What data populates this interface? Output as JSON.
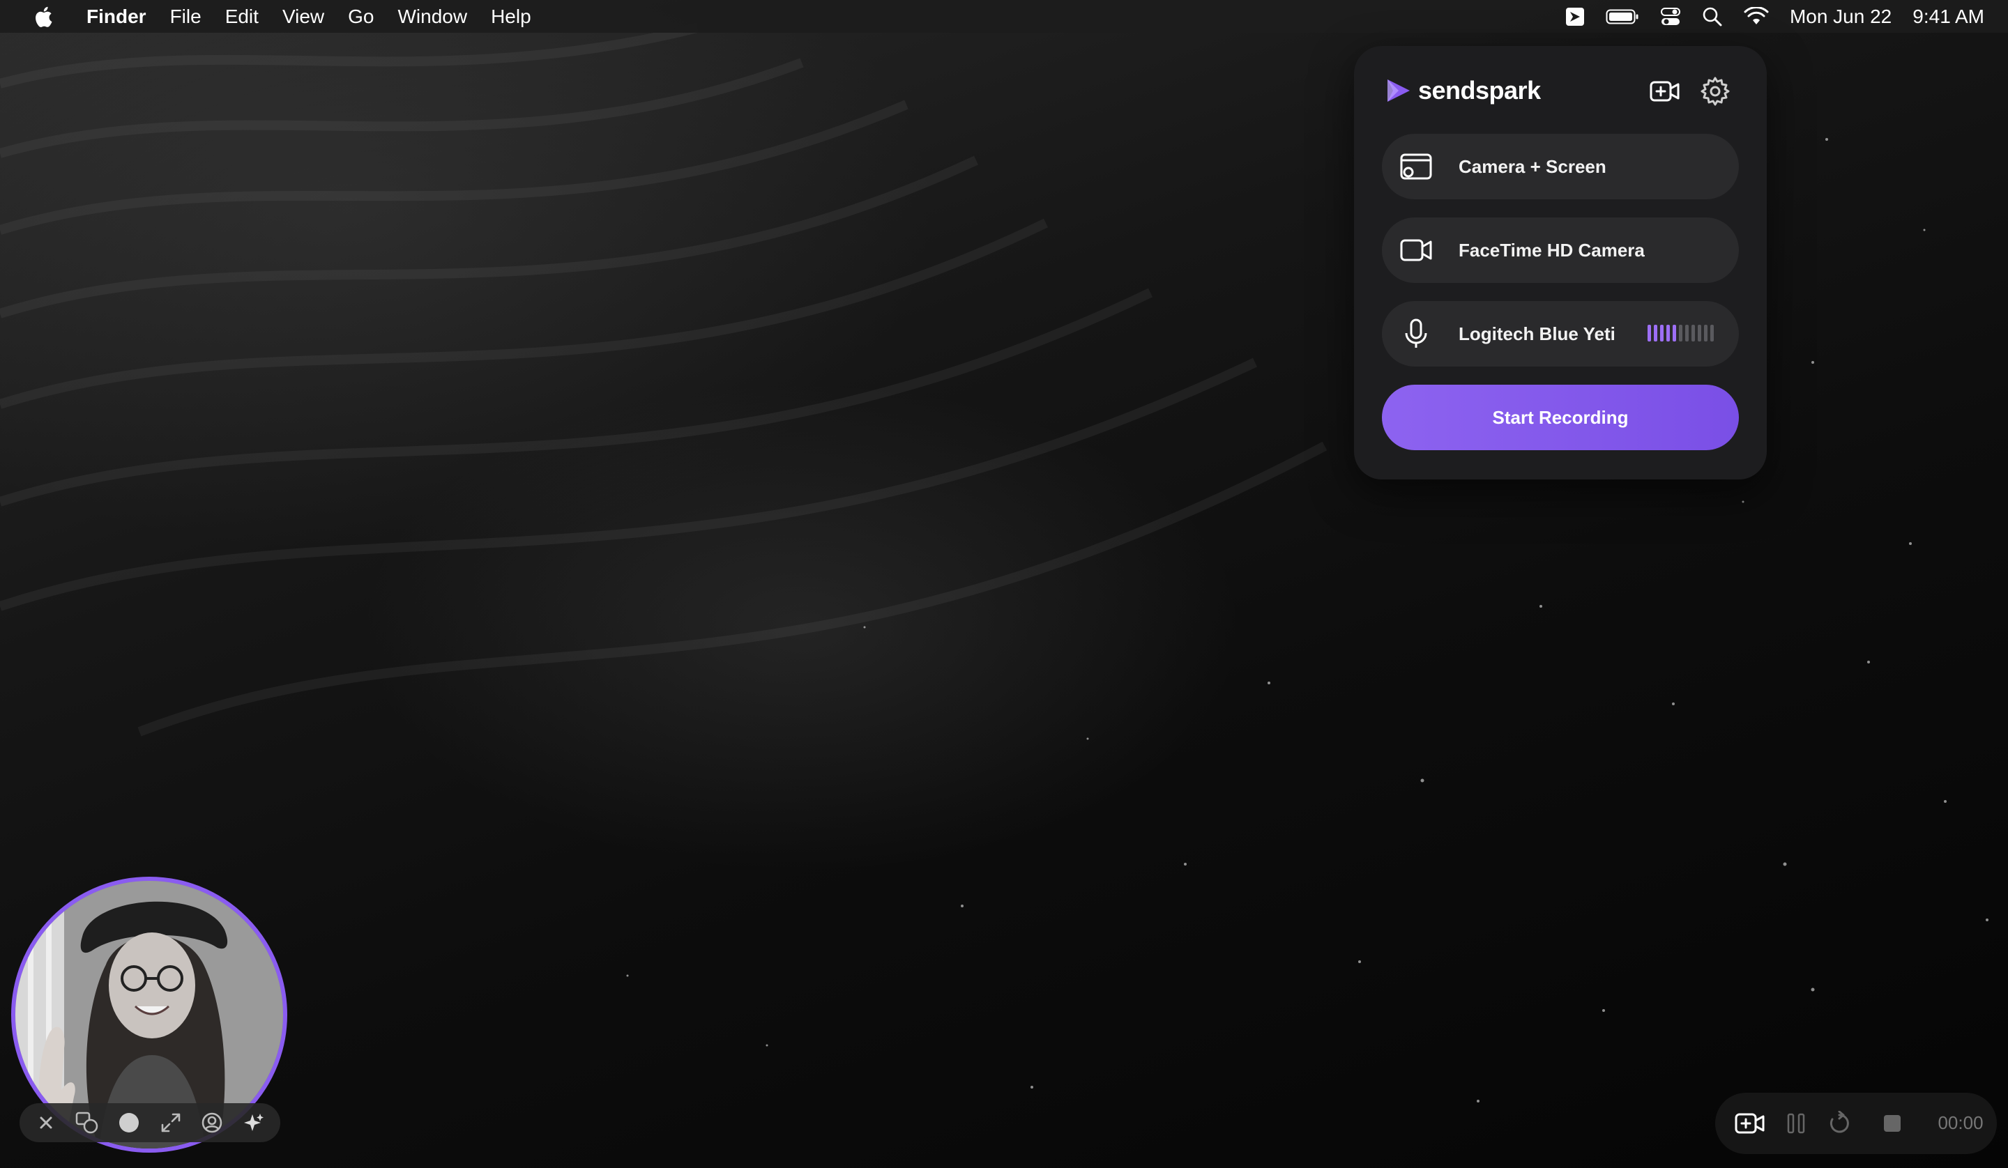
{
  "menubar": {
    "app_name": "Finder",
    "menus": [
      "File",
      "Edit",
      "View",
      "Go",
      "Window",
      "Help"
    ],
    "date": "Mon Jun 22",
    "time": "9:41 AM",
    "status_icons": [
      "sendspark-icon",
      "battery-icon",
      "control-center-icon",
      "spotlight-search-icon",
      "wifi-icon"
    ]
  },
  "panel": {
    "brand_name": "sendspark",
    "options": [
      {
        "label": "Camera + Screen",
        "icon": "camera-screen-icon"
      },
      {
        "label": "FaceTime HD Camera",
        "icon": "video-camera-icon"
      },
      {
        "label": "Logitech Blue Yeti",
        "icon": "microphone-icon",
        "level": 0.45
      }
    ],
    "start_label": "Start Recording",
    "accent": "#8a5cf0"
  },
  "webcam": {
    "toolbar_icons": [
      "close-icon",
      "switch-view-icon",
      "record-dot-icon",
      "expand-icon",
      "avatar-icon",
      "effects-sparkle-icon"
    ]
  },
  "recorder": {
    "timer": "00:00",
    "icons": [
      "add-video-icon",
      "pause-icon",
      "restart-icon",
      "stop-icon"
    ]
  }
}
